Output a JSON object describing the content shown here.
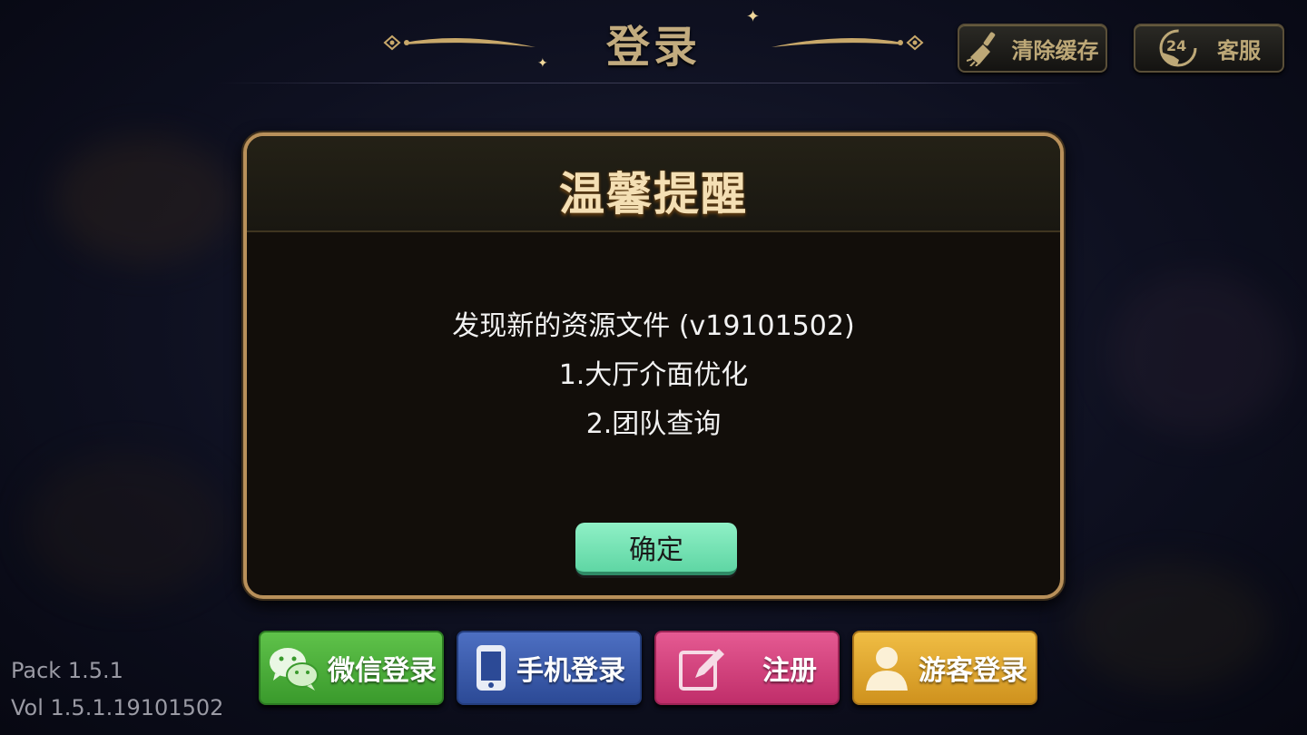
{
  "header": {
    "title": "登录",
    "clear_cache_label": "清除缓存",
    "service_label": "客服",
    "service_badge": "24"
  },
  "dialog": {
    "title": "温馨提醒",
    "lines": [
      "发现新的资源文件 (v19101502)",
      "1.大厅介面优化",
      "2.团队查询"
    ],
    "confirm_label": "确定"
  },
  "login_buttons": {
    "wechat": "微信登录",
    "phone": "手机登录",
    "register": "注册",
    "guest": "游客登录"
  },
  "version": {
    "pack": "Pack 1.5.1",
    "vol": "Vol 1.5.1.19101502"
  },
  "colors": {
    "wechat": "#4caf3d",
    "phone": "#3b5aa8",
    "register": "#d2407c",
    "guest": "#e0a92e",
    "accent_gold": "#b8905a",
    "confirm": "#6fe0b0"
  }
}
